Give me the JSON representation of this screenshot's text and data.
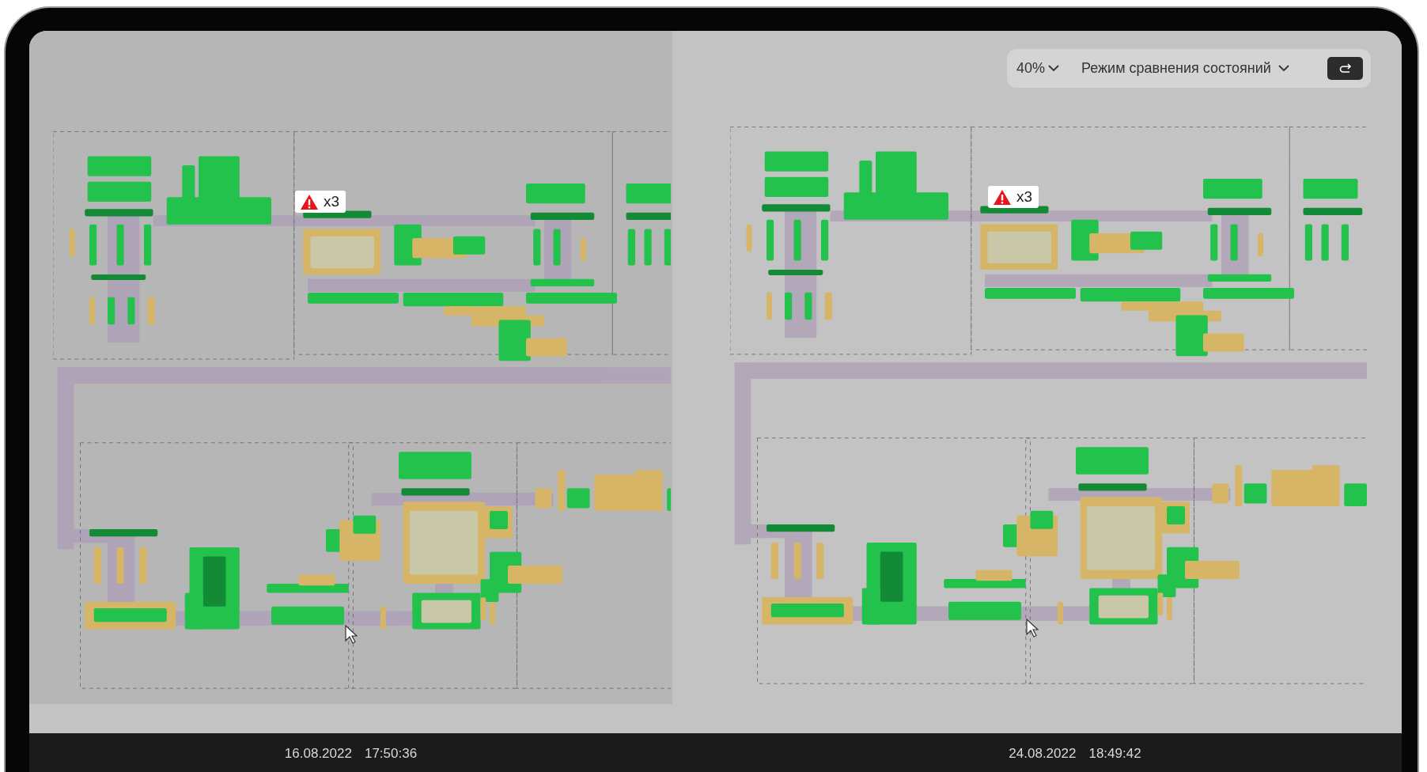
{
  "toolbar": {
    "zoom": "40%",
    "mode": "Режим сравнения состояний"
  },
  "panels": [
    {
      "kind": "baseline",
      "alert": {
        "count": "x3"
      },
      "date": "16.08.2022",
      "time": "17:50:36"
    },
    {
      "kind": "comparison",
      "alert": {
        "count": "x3"
      },
      "date": "24.08.2022",
      "time": "18:49:42"
    }
  ]
}
